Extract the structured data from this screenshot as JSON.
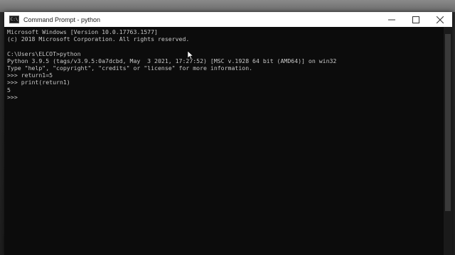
{
  "window": {
    "title": "Command Prompt - python",
    "app_icon_text": "C:\\",
    "controls": {
      "minimize": "minimize-icon",
      "maximize": "maximize-icon",
      "close": "close-icon"
    }
  },
  "console": {
    "lines": [
      "Microsoft Windows [Version 10.0.17763.1577]",
      "(c) 2018 Microsoft Corporation. All rights reserved.",
      "",
      "C:\\Users\\ELCOT>python",
      "Python 3.9.5 (tags/v3.9.5:0a7dcbd, May  3 2021, 17:27:52) [MSC v.1928 64 bit (AMD64)] on win32",
      "Type \"help\", \"copyright\", \"credits\" or \"license\" for more information.",
      ">>> return1=5",
      ">>> print(return1)",
      "5",
      ">>> "
    ]
  },
  "colors": {
    "console_background": "#0c0c0c",
    "console_text": "#c8c8c8",
    "titlebar": "#ffffff"
  }
}
